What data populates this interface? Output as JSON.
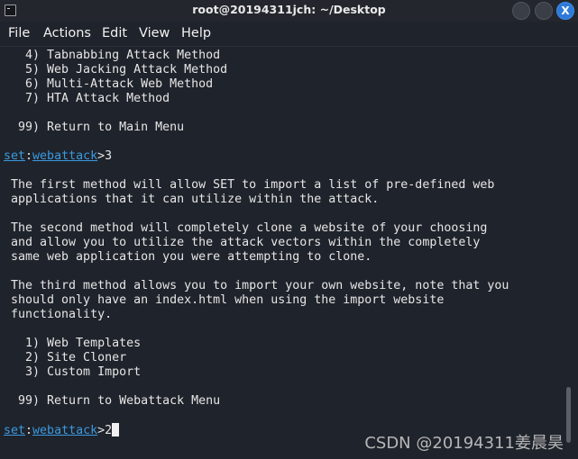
{
  "window": {
    "title": "root@20194311jch: ~/Desktop",
    "close_label": "X"
  },
  "menu": [
    "File",
    "Actions",
    "Edit",
    "View",
    "Help"
  ],
  "terminal": {
    "menu_items": [
      "   4) Tabnabbing Attack Method",
      "   5) Web Jacking Attack Method",
      "   6) Multi-Attack Web Method",
      "   7) HTA Attack Method"
    ],
    "return_main": "  99) Return to Main Menu",
    "prompt1": {
      "set": "set",
      "sep": ":",
      "module": "webattack",
      "input": ">3"
    },
    "paragraphs": [
      [
        " The first method will allow SET to import a list of pre-defined web",
        " applications that it can utilize within the attack."
      ],
      [
        " The second method will completely clone a website of your choosing",
        " and allow you to utilize the attack vectors within the completely",
        " same web application you were attempting to clone."
      ],
      [
        " The third method allows you to import your own website, note that you",
        " should only have an index.html when using the import website",
        " functionality."
      ]
    ],
    "options": [
      "   1) Web Templates",
      "   2) Site Cloner",
      "   3) Custom Import"
    ],
    "return_webattack": "  99) Return to Webattack Menu",
    "prompt2": {
      "set": "set",
      "sep": ":",
      "module": "webattack",
      "input": ">2"
    }
  },
  "watermark": "CSDN @20194311姜晨昊",
  "colors": {
    "background": "#1f232b",
    "link": "#3b9ae0",
    "close_button": "#2f7ad8"
  }
}
